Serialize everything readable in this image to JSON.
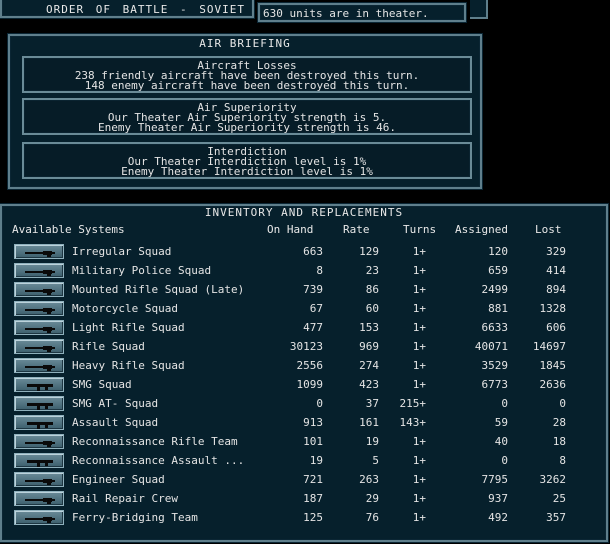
{
  "top_bar": {
    "title": "ORDER OF BATTLE - SOVIET",
    "units_text": "630 units are in theater."
  },
  "air_briefing": {
    "title": "AIR BRIEFING",
    "losses": {
      "heading": "Aircraft Losses",
      "line1": "238 friendly aircraft have been destroyed this turn.",
      "line2": "148 enemy aircraft have been destroyed this turn."
    },
    "superiority": {
      "heading": "Air Superiority",
      "line1": "Our Theater Air Superiority strength is 5.",
      "line2": "Enemy Theater Air Superiority strength is 46."
    },
    "interdiction": {
      "heading": "Interdiction",
      "line1": "Our Theater Interdiction level is 1%",
      "line2": "Enemy Theater Interdiction level is 1%"
    }
  },
  "inventory": {
    "title": "INVENTORY AND REPLACEMENTS",
    "headers": {
      "systems": "Available Systems",
      "on_hand": "On Hand",
      "rate": "Rate",
      "turns": "Turns",
      "assigned": "Assigned",
      "lost": "Lost"
    },
    "rows": [
      {
        "name": "Irregular Squad",
        "on_hand": "663",
        "rate": "129",
        "turns": "1+",
        "assigned": "120",
        "lost": "329",
        "icon": "rifle-icon"
      },
      {
        "name": "Military Police Squad",
        "on_hand": "8",
        "rate": "23",
        "turns": "1+",
        "assigned": "659",
        "lost": "414",
        "icon": "rifle-icon"
      },
      {
        "name": "Mounted Rifle Squad (Late)",
        "on_hand": "739",
        "rate": "86",
        "turns": "1+",
        "assigned": "2499",
        "lost": "894",
        "icon": "horse-rider-icon"
      },
      {
        "name": "Motorcycle Squad",
        "on_hand": "67",
        "rate": "60",
        "turns": "1+",
        "assigned": "881",
        "lost": "1328",
        "icon": "motorcycle-icon"
      },
      {
        "name": "Light Rifle Squad",
        "on_hand": "477",
        "rate": "153",
        "turns": "1+",
        "assigned": "6633",
        "lost": "606",
        "icon": "rifle-icon"
      },
      {
        "name": "Rifle Squad",
        "on_hand": "30123",
        "rate": "969",
        "turns": "1+",
        "assigned": "40071",
        "lost": "14697",
        "icon": "rifle-icon"
      },
      {
        "name": "Heavy Rifle Squad",
        "on_hand": "2556",
        "rate": "274",
        "turns": "1+",
        "assigned": "3529",
        "lost": "1845",
        "icon": "rifle-icon"
      },
      {
        "name": "SMG Squad",
        "on_hand": "1099",
        "rate": "423",
        "turns": "1+",
        "assigned": "6773",
        "lost": "2636",
        "icon": "submachine-gun-icon"
      },
      {
        "name": "SMG AT- Squad",
        "on_hand": "0",
        "rate": "37",
        "turns": "215+",
        "assigned": "0",
        "lost": "0",
        "icon": "submachine-gun-icon"
      },
      {
        "name": "Assault Squad",
        "on_hand": "913",
        "rate": "161",
        "turns": "143+",
        "assigned": "59",
        "lost": "28",
        "icon": "assault-rifle-icon"
      },
      {
        "name": "Reconnaissance Rifle Team",
        "on_hand": "101",
        "rate": "19",
        "turns": "1+",
        "assigned": "40",
        "lost": "18",
        "icon": "rifle-icon"
      },
      {
        "name": "Reconnaissance Assault ...",
        "on_hand": "19",
        "rate": "5",
        "turns": "1+",
        "assigned": "0",
        "lost": "8",
        "icon": "assault-rifle-icon"
      },
      {
        "name": "Engineer Squad",
        "on_hand": "721",
        "rate": "263",
        "turns": "1+",
        "assigned": "7795",
        "lost": "3262",
        "icon": "rifle-icon"
      },
      {
        "name": "Rail Repair Crew",
        "on_hand": "187",
        "rate": "29",
        "turns": "1+",
        "assigned": "937",
        "lost": "25",
        "icon": "rifle-icon"
      },
      {
        "name": "Ferry-Bridging Team",
        "on_hand": "125",
        "rate": "76",
        "turns": "1+",
        "assigned": "492",
        "lost": "357",
        "icon": "rifle-icon"
      }
    ]
  },
  "colors": {
    "background": "#000000",
    "panel": "#06202c",
    "border": "#5f7f8c",
    "button": "#4d707e",
    "text": "#e4e4e4"
  }
}
